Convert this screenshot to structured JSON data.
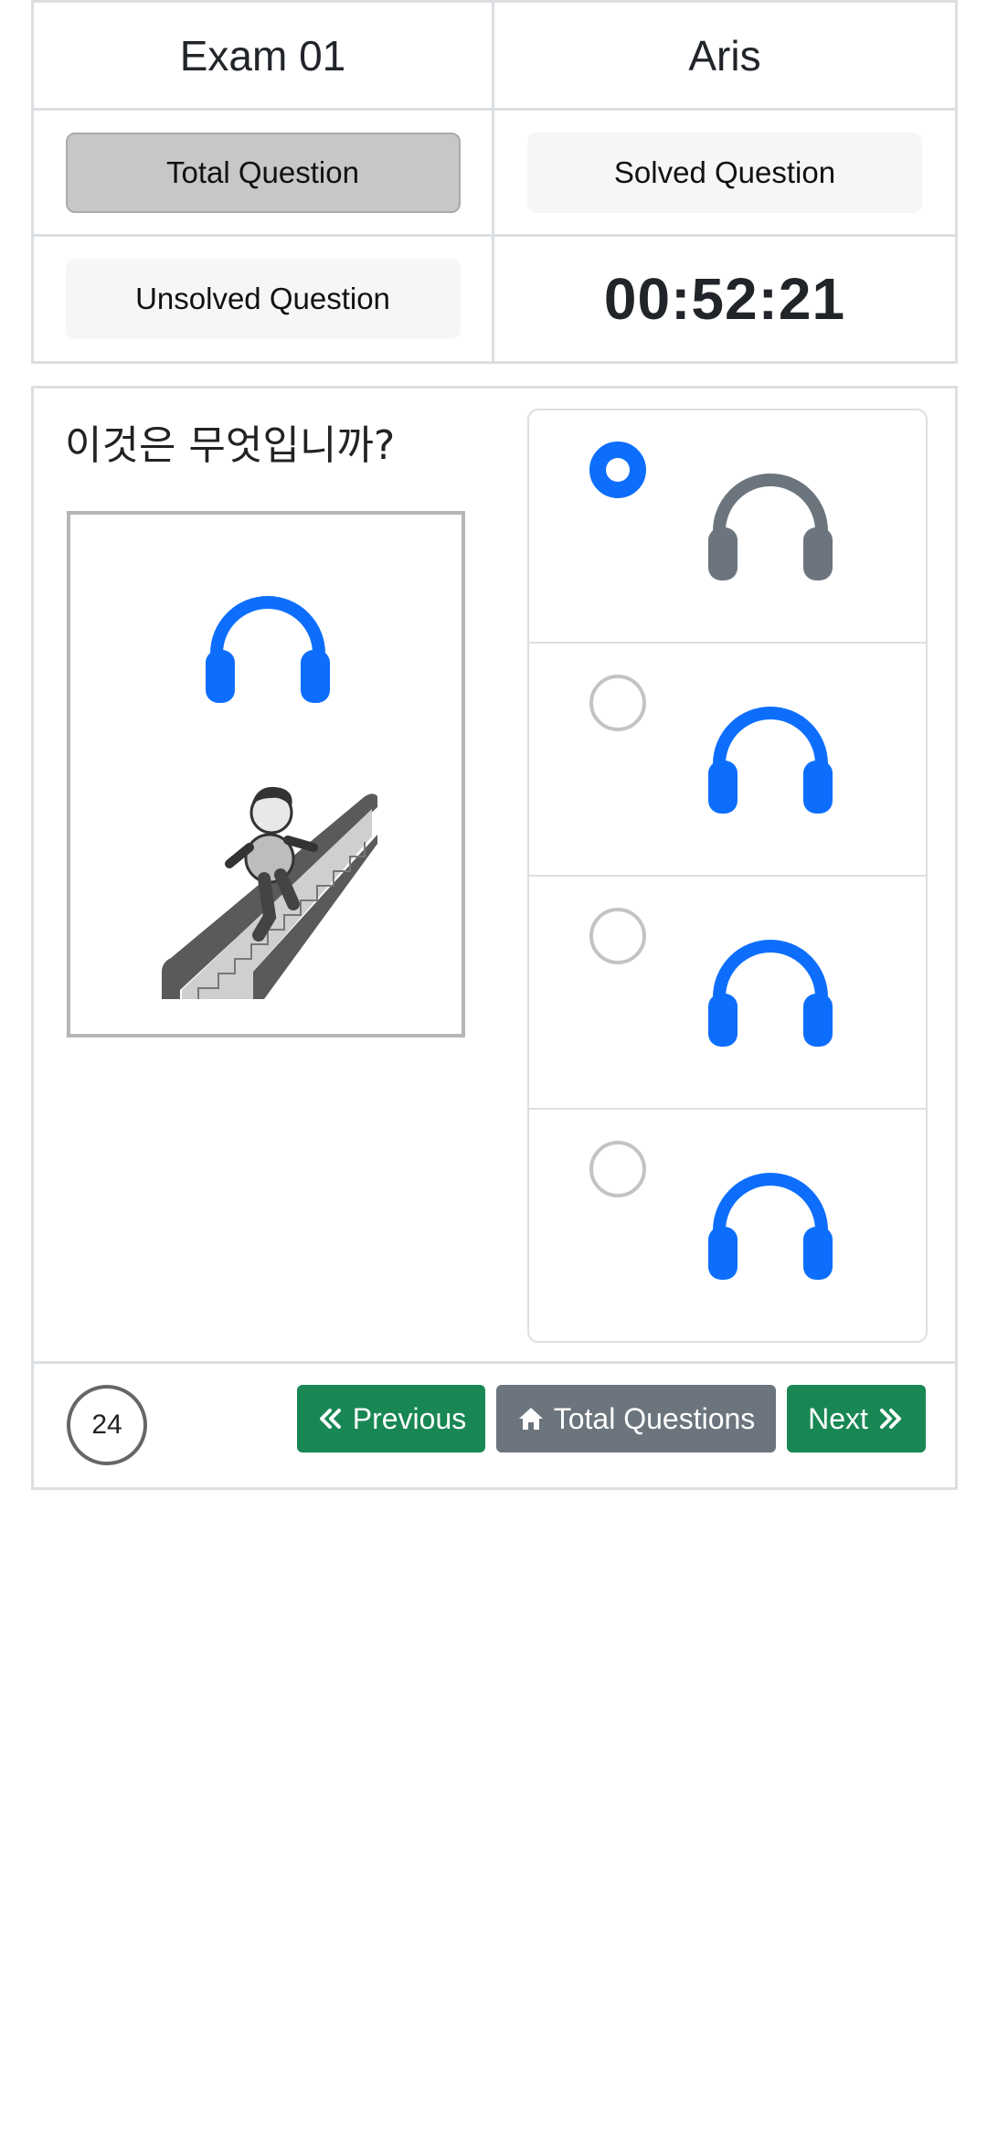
{
  "header": {
    "exam_title": "Exam 01",
    "user_name": "Aris",
    "total_question_label": "Total Question",
    "solved_question_label": "Solved Question",
    "unsolved_question_label": "Unsolved Question",
    "timer": "00:52:21"
  },
  "question": {
    "text": "이것은 무엇입니까?",
    "image_icon": "headphones-icon",
    "image_illustration": "escalator-illustration",
    "options": [
      {
        "icon": "headphones-icon",
        "selected": true,
        "color": "#6c757d"
      },
      {
        "icon": "headphones-icon",
        "selected": false,
        "color": "#0d6efd"
      },
      {
        "icon": "headphones-icon",
        "selected": false,
        "color": "#0d6efd"
      },
      {
        "icon": "headphones-icon",
        "selected": false,
        "color": "#0d6efd"
      }
    ]
  },
  "footer": {
    "question_number": "24",
    "previous_label": "Previous",
    "total_questions_label": "Total Questions",
    "next_label": "Next"
  },
  "colors": {
    "primary": "#0d6efd",
    "success": "#198754",
    "secondary": "#6c757d",
    "border": "#dcdfe2"
  }
}
